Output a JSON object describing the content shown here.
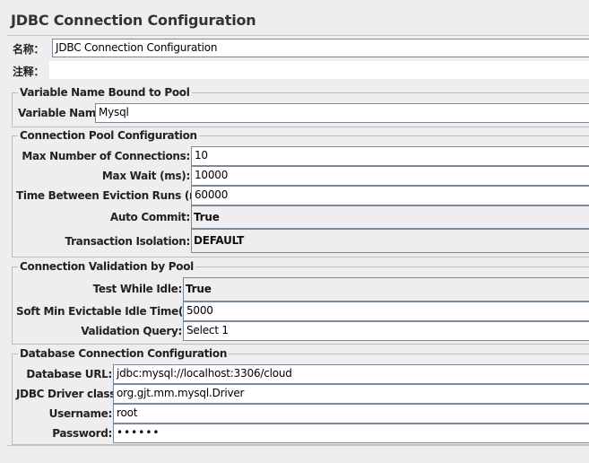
{
  "window": {
    "title": "JDBC Connection Configuration"
  },
  "name_row": {
    "label": "名称：",
    "value": "JDBC Connection Configuration"
  },
  "comment_row": {
    "label": "注释：",
    "value": ""
  },
  "variable_group": {
    "title": "Variable Name Bound to Pool",
    "variable_name_label": "Variable Name:",
    "variable_name_value": "Mysql"
  },
  "pool_group": {
    "title": "Connection Pool Configuration",
    "max_connections_label": "Max Number of Connections:",
    "max_connections_value": "10",
    "max_wait_label": "Max Wait (ms):",
    "max_wait_value": "10000",
    "eviction_label": "Time Between Eviction Runs (ms):",
    "eviction_value": "60000",
    "auto_commit_label": "Auto Commit:",
    "auto_commit_value": "True",
    "isolation_label": "Transaction Isolation:",
    "isolation_value": "DEFAULT"
  },
  "validation_group": {
    "title": "Connection Validation by Pool",
    "test_idle_label": "Test While Idle:",
    "test_idle_value": "True",
    "soft_min_label": "Soft Min Evictable Idle Time(ms):",
    "soft_min_value": "5000",
    "query_label": "Validation Query:",
    "query_value": "Select 1"
  },
  "db_group": {
    "title": "Database Connection Configuration",
    "url_label": "Database URL:",
    "url_value": "jdbc:mysql://localhost:3306/cloud",
    "driver_label": "JDBC Driver class:",
    "driver_value": "org.gjt.mm.mysql.Driver",
    "username_label": "Username:",
    "username_value": "root",
    "password_label": "Password:",
    "password_value": "••••••"
  }
}
